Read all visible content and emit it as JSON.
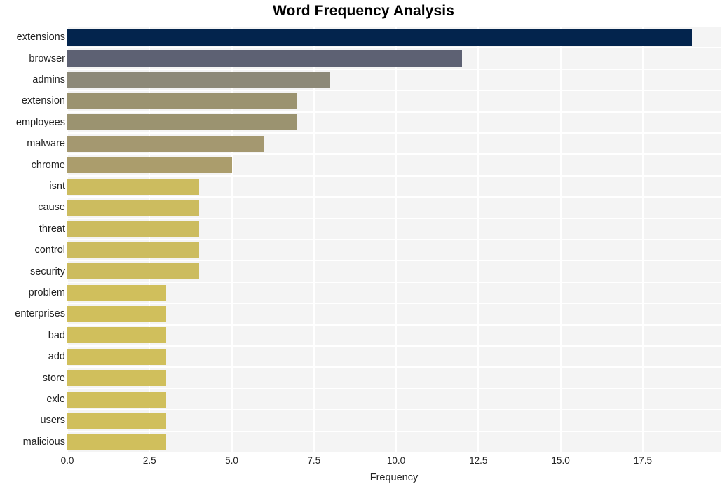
{
  "chart_data": {
    "type": "bar",
    "orientation": "horizontal",
    "title": "Word Frequency Analysis",
    "xlabel": "Frequency",
    "ylabel": "",
    "categories": [
      "extensions",
      "browser",
      "admins",
      "extension",
      "employees",
      "malware",
      "chrome",
      "isnt",
      "cause",
      "threat",
      "control",
      "security",
      "problem",
      "enterprises",
      "bad",
      "add",
      "store",
      "exle",
      "users",
      "malicious"
    ],
    "values": [
      19,
      12,
      8,
      7,
      7,
      6,
      5,
      4,
      4,
      4,
      4,
      4,
      3,
      3,
      3,
      3,
      3,
      3,
      3,
      3
    ],
    "bar_colors": [
      "#03244d",
      "#5d6173",
      "#8d8978",
      "#9b9370",
      "#9b9370",
      "#a49870",
      "#ab9d6c",
      "#ccbc5f",
      "#ccbc5f",
      "#ccbc5f",
      "#ccbc5f",
      "#ccbc5f",
      "#d0bf5c",
      "#d0bf5c",
      "#d0bf5c",
      "#d0bf5c",
      "#d0bf5c",
      "#d0bf5c",
      "#d0bf5c",
      "#d0bf5c"
    ],
    "xticks": [
      0.0,
      2.5,
      5.0,
      7.5,
      10.0,
      12.5,
      15.0,
      17.5
    ],
    "xtick_labels": [
      "0.0",
      "2.5",
      "5.0",
      "7.5",
      "10.0",
      "12.5",
      "15.0",
      "17.5"
    ],
    "xlim": [
      0,
      19.87
    ],
    "grid": true,
    "grid_color": "#ffffff",
    "plot_background": "#f4f4f4",
    "figure_background": "#ffffff",
    "legend": null
  }
}
